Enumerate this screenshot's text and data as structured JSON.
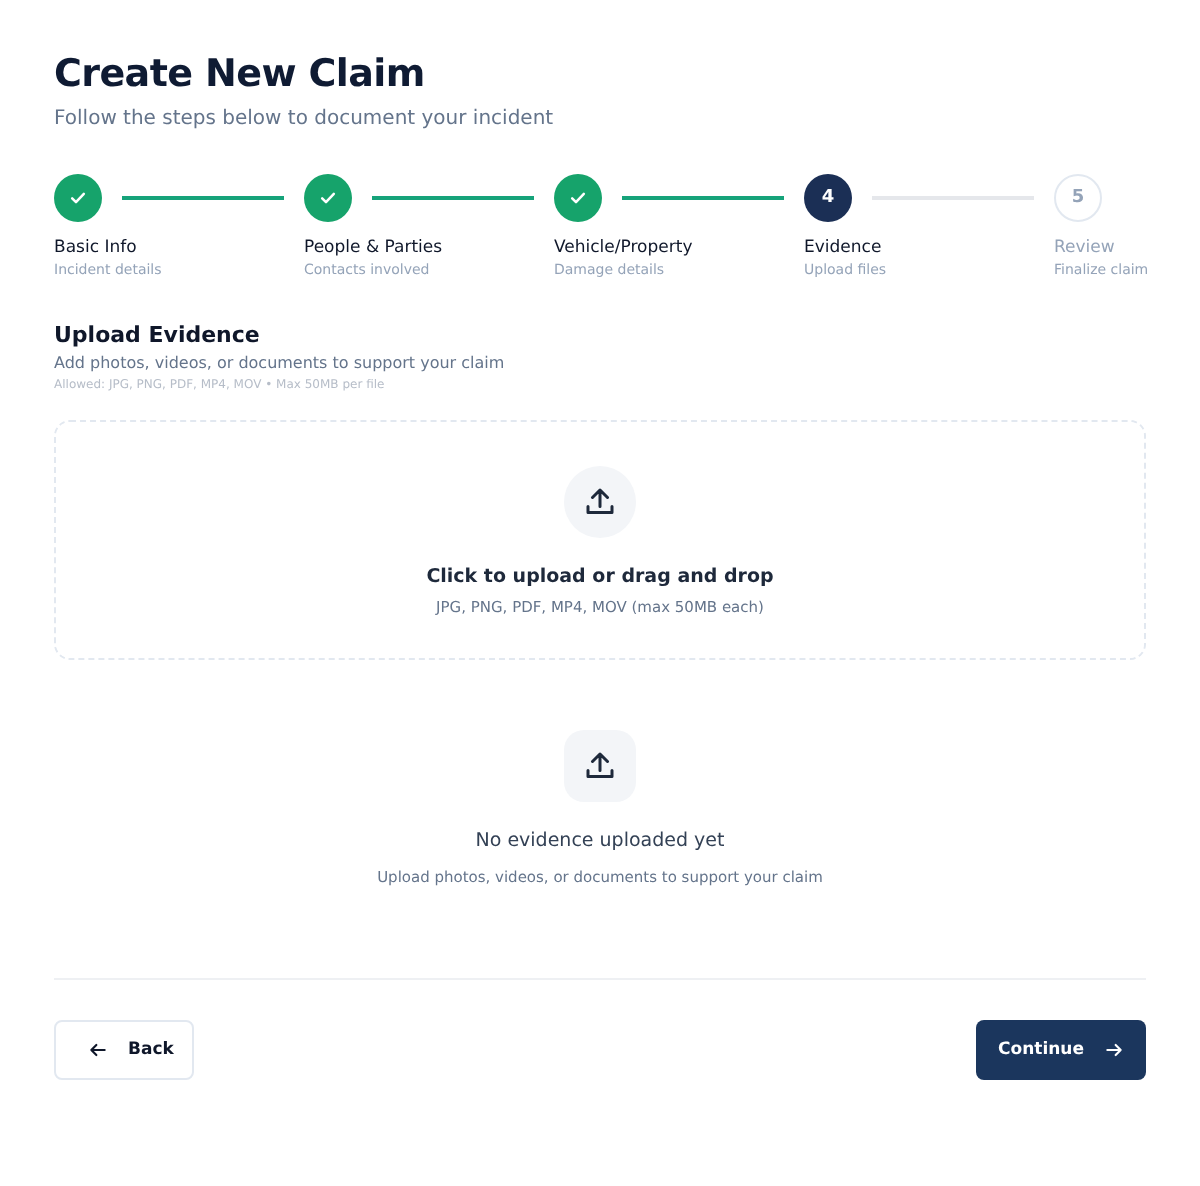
{
  "header": {
    "title": "Create New Claim",
    "subtitle": "Follow the steps below to document your incident"
  },
  "steps": [
    {
      "label": "Basic Info",
      "description": "Incident details",
      "completed": true,
      "selected": false
    },
    {
      "label": "People & Parties",
      "description": "Contacts involved",
      "completed": true,
      "selected": false
    },
    {
      "label": "Vehicle/Property",
      "description": "Damage details",
      "completed": true,
      "selected": false
    },
    {
      "number": "4",
      "label": "Evidence",
      "description": "Upload files",
      "completed": false,
      "selected": true
    },
    {
      "number": "5",
      "label": "Review",
      "description": "Finalize claim",
      "completed": false,
      "selected": false
    }
  ],
  "section": {
    "title": "Upload Evidence",
    "description": "Add photos, videos, or documents to support your claim",
    "allowed": "Allowed: JPG, PNG, PDF, MP4, MOV • Max 50MB per file"
  },
  "dropzone": {
    "title": "Click to upload or drag and drop",
    "hint": "JPG, PNG, PDF, MP4, MOV (max 50MB each)"
  },
  "empty_state": {
    "title": "No evidence uploaded yet",
    "hint": "Upload photos, videos, or documents to support your claim"
  },
  "buttons": {
    "back": "Back",
    "continue": "Continue"
  }
}
